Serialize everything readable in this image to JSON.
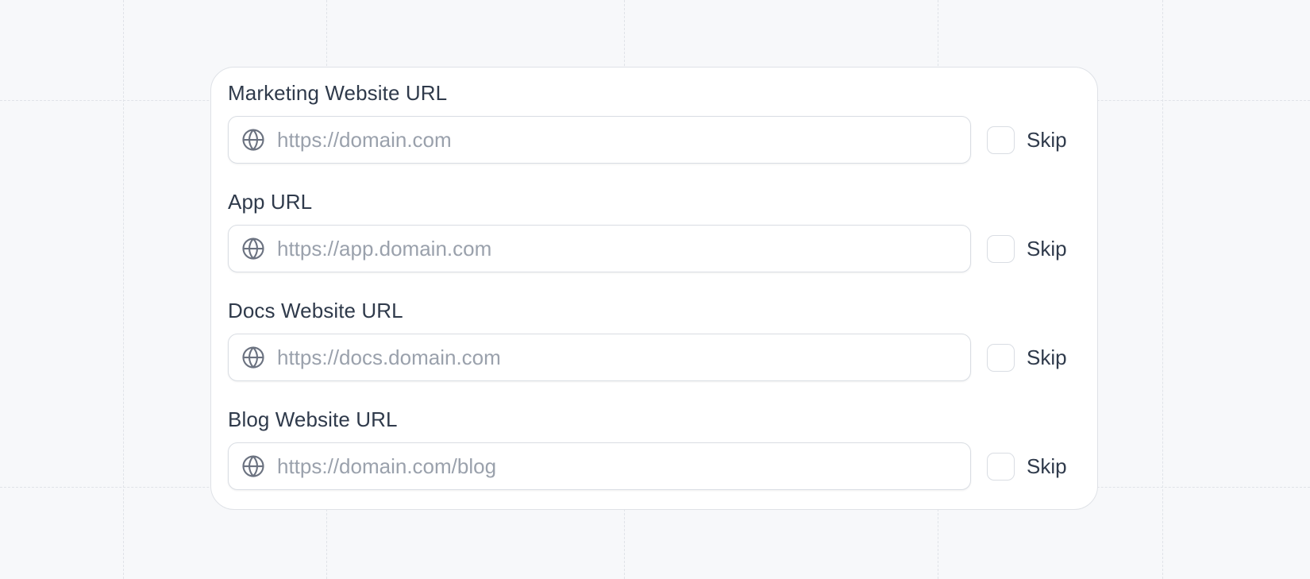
{
  "fields": [
    {
      "label": "Marketing Website URL",
      "placeholder": "https://domain.com",
      "skip_label": "Skip",
      "icon": "globe-icon"
    },
    {
      "label": "App URL",
      "placeholder": "https://app.domain.com",
      "skip_label": "Skip",
      "icon": "globe-icon"
    },
    {
      "label": "Docs Website URL",
      "placeholder": "https://docs.domain.com",
      "skip_label": "Skip",
      "icon": "globe-icon"
    },
    {
      "label": "Blog Website URL",
      "placeholder": "https://domain.com/blog",
      "skip_label": "Skip",
      "icon": "globe-icon"
    }
  ],
  "colors": {
    "background": "#f7f8fa",
    "card": "#ffffff",
    "border": "#d9dde3",
    "text": "#2f3a4b",
    "placeholder": "#9aa1ac",
    "icon": "#6b7280"
  }
}
